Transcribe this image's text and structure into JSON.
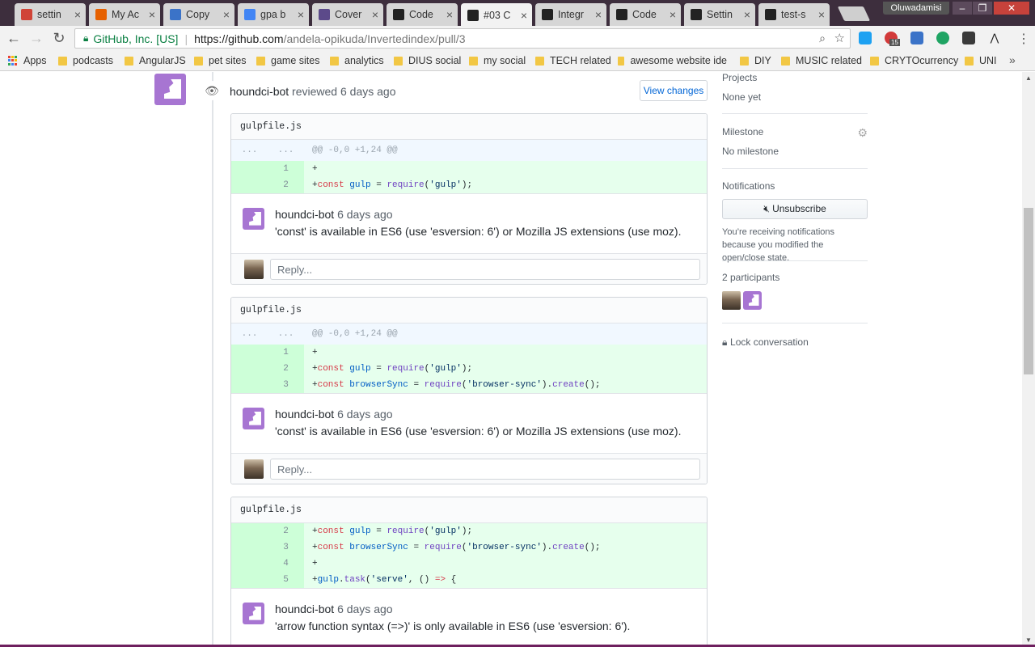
{
  "browser": {
    "tabs": [
      {
        "label": "settin",
        "icon": "trello-icon",
        "color": "#d04437"
      },
      {
        "label": "My Ac",
        "icon": "firefox-icon",
        "color": "#e66000"
      },
      {
        "label": "Copy",
        "icon": "window-icon",
        "color": "#3b73c8"
      },
      {
        "label": "gpa b",
        "icon": "google-icon",
        "color": "#4285f4"
      },
      {
        "label": "Cover",
        "icon": "star-icon",
        "color": "#5c4a8a"
      },
      {
        "label": "Code",
        "icon": "codewars-icon",
        "color": "#222"
      },
      {
        "label": "#03 C",
        "icon": "github-icon",
        "color": "#222"
      },
      {
        "label": "Integr",
        "icon": "github-icon",
        "color": "#222"
      },
      {
        "label": "Code",
        "icon": "codewars-icon",
        "color": "#222"
      },
      {
        "label": "Settin",
        "icon": "codewars-icon",
        "color": "#222"
      },
      {
        "label": "test-s",
        "icon": "github-icon",
        "color": "#222"
      }
    ],
    "profile_name": "Oluwadamisi",
    "address": {
      "org": "GitHub, Inc. [US]",
      "host": "https://github.com",
      "path": "/andela-opikuda/Invertedindex/pull/3"
    },
    "ext_badge": "15",
    "bookmarks": [
      {
        "label": "Apps",
        "icon": "apps-grid-icon"
      },
      {
        "label": "podcasts"
      },
      {
        "label": "AngularJS"
      },
      {
        "label": "pet sites"
      },
      {
        "label": "game sites"
      },
      {
        "label": "analytics"
      },
      {
        "label": "DIUS social"
      },
      {
        "label": "my social"
      },
      {
        "label": "TECH related"
      },
      {
        "label": "awesome website ide"
      },
      {
        "label": "DIY"
      },
      {
        "label": "MUSIC related"
      },
      {
        "label": "CRYTOcurrency"
      },
      {
        "label": "UNI"
      }
    ],
    "bookmarks_more": "»"
  },
  "review": {
    "reviewer": "houndci-bot",
    "action": " reviewed ",
    "time": "6 days ago",
    "view_changes": "View changes"
  },
  "threads": [
    {
      "file": "gulpfile.js",
      "hunk": "@@ -0,0 +1,24 @@",
      "lines": [
        {
          "n": "1",
          "code": "+"
        },
        {
          "n": "2",
          "code": "+const gulp = require('gulp');"
        }
      ],
      "comment": {
        "author": "houndci-bot",
        "time": "6 days ago",
        "text": "'const' is available in ES6 (use 'esversion: 6') or Mozilla JS extensions (use moz)."
      },
      "reply_placeholder": "Reply..."
    },
    {
      "file": "gulpfile.js",
      "hunk": "@@ -0,0 +1,24 @@",
      "lines": [
        {
          "n": "1",
          "code": "+"
        },
        {
          "n": "2",
          "code": "+const gulp = require('gulp');"
        },
        {
          "n": "3",
          "code": "+const browserSync = require('browser-sync').create();"
        }
      ],
      "comment": {
        "author": "houndci-bot",
        "time": "6 days ago",
        "text": "'const' is available in ES6 (use 'esversion: 6') or Mozilla JS extensions (use moz)."
      },
      "reply_placeholder": "Reply..."
    },
    {
      "file": "gulpfile.js",
      "lines": [
        {
          "n": "2",
          "code": "+const gulp = require('gulp');"
        },
        {
          "n": "3",
          "code": "+const browserSync = require('browser-sync').create();"
        },
        {
          "n": "4",
          "code": "+"
        },
        {
          "n": "5",
          "code": "+gulp.task('serve', () => {"
        }
      ],
      "comment": {
        "author": "houndci-bot",
        "time": "6 days ago",
        "text": "'arrow function syntax (=>)' is only available in ES6 (use 'esversion: 6')."
      }
    }
  ],
  "sidebar": {
    "projects_title": "Projects",
    "projects_value": "None yet",
    "milestone_title": "Milestone",
    "milestone_value": "No milestone",
    "notifications_title": "Notifications",
    "unsubscribe_label": "Unsubscribe",
    "notifications_note": "You’re receiving notifications because you modified the open/close state.",
    "participants_title": "2 participants",
    "lock_label": "Lock conversation"
  },
  "colors": {
    "bot_avatar": "#a775d2",
    "diff_add_bg": "#e6ffed",
    "link": "#0366d6"
  }
}
